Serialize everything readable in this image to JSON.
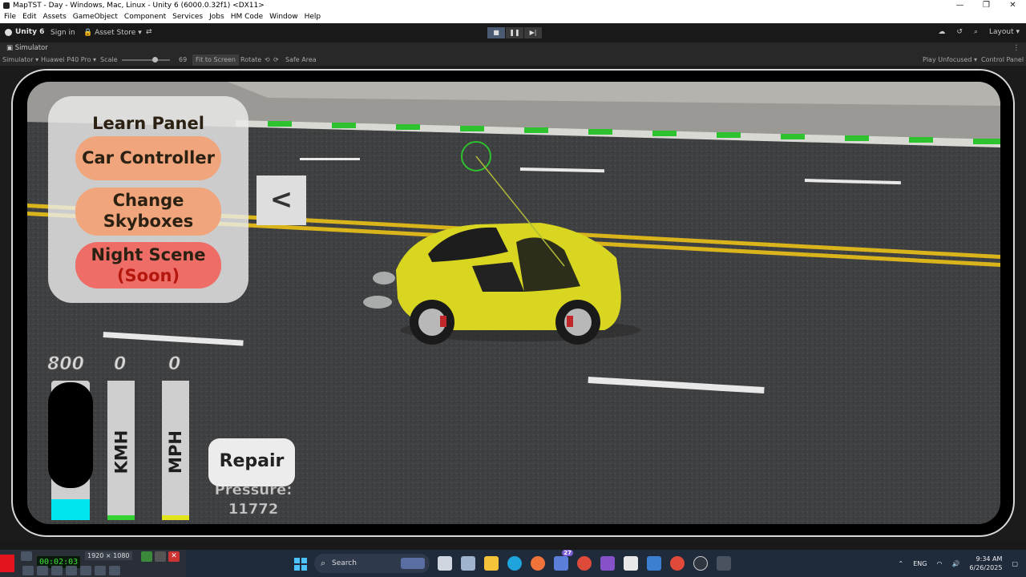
{
  "window": {
    "title": "MapTST - Day - Windows, Mac, Linux - Unity 6 (6000.0.32f1) <DX11>",
    "controls": [
      "—",
      "❐",
      "✕"
    ]
  },
  "menu": [
    "File",
    "Edit",
    "Assets",
    "GameObject",
    "Component",
    "Services",
    "Jobs",
    "HM Code",
    "Window",
    "Help"
  ],
  "toolbar": {
    "unity_label": "Unity 6",
    "signin_label": "Sign in",
    "asset_store_label": "Asset Store ▾",
    "layout_label": "Layout ▾",
    "play_states": {
      "play": "active"
    }
  },
  "simulator": {
    "tab_label": "Simulator",
    "mode_label": "Simulator ▾",
    "device_label": "Huawei P40 Pro ▾",
    "scale_label": "Scale",
    "scale_value": "69",
    "fit_label": "Fit to Screen",
    "rotate_label": "Rotate",
    "safe_area_label": "Safe Area",
    "play_focus_label": "Play Unfocused ▾",
    "control_panel_label": "Control Panel"
  },
  "game": {
    "learn_panel": {
      "title": "Learn Panel",
      "buttons": {
        "car_controller": "Car Controller",
        "change_skyboxes_line1": "Change",
        "change_skyboxes_line2": "Skyboxes",
        "night_scene_line1": "Night Scene",
        "night_scene_line2": "(Soon)"
      }
    },
    "back_button_label": "<",
    "gauges": {
      "rpm_value": "800",
      "kmh_value": "0",
      "mph_value": "0",
      "kmh_label": "KMH",
      "mph_label": "MPH"
    },
    "repair_label": "Repair",
    "pressure_line1": "Pressure:",
    "pressure_line2": "11772",
    "colors": {
      "car": "#e2e020",
      "panel_button": "#f0a57d",
      "night_button": "#ee6d66",
      "rpm_fill": "#00e5ee",
      "kmh_fill": "#34d034",
      "mph_fill": "#e4e41c"
    }
  },
  "recorder": {
    "time": "00:02:03",
    "resolution": "1920 × 1080"
  },
  "taskbar": {
    "search_placeholder": "Search",
    "notification_badge": "27",
    "lang": "ENG",
    "time": "9:34 AM",
    "date": "6/26/2025"
  }
}
